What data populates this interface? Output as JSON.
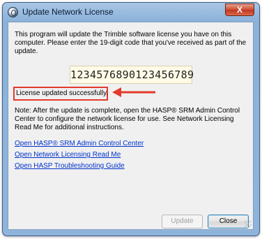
{
  "window": {
    "title": "Update Network License",
    "close_symbol": "X"
  },
  "content": {
    "intro": "This program will update the Trimble software license you have on this computer. Please enter the 19-digit code that you've received as part of the update.",
    "license_code": "1234576890123456789",
    "status": "License updated successfully.",
    "note": "Note: After the update is complete, open the HASP® SRM Admin Control Center to configure the network license for use. See Network Licensing Read Me for additional instructions."
  },
  "links": [
    {
      "label": "Open HASP® SRM Admin Control Center"
    },
    {
      "label": "Open Network Licensing Read Me"
    },
    {
      "label": "Open HASP Troubleshooting Guide"
    }
  ],
  "buttons": {
    "update": "Update",
    "close": "Close"
  },
  "colors": {
    "highlight": "#e23a2c",
    "link": "#0033cc",
    "code_background": "#fffbe6"
  }
}
